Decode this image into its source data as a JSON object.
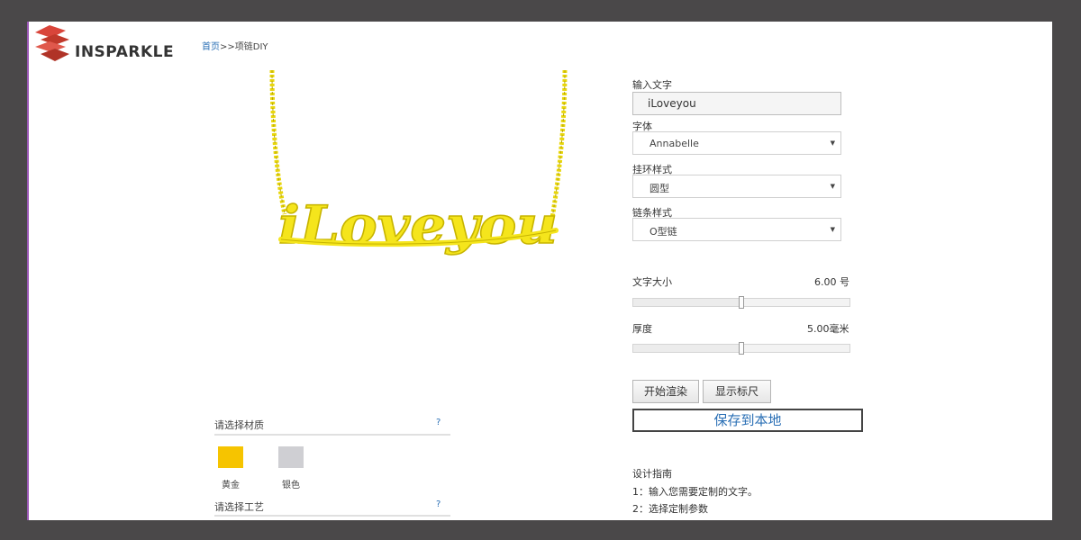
{
  "header": {
    "brand": "INSPARKLE",
    "breadcrumb_home": "首页",
    "breadcrumb_rest": ">>项链DIY"
  },
  "preview": {
    "engraved_text": "iLoveyou",
    "metal_color": "#f5e51c"
  },
  "form": {
    "text_label": "输入文字",
    "text_value": "iLoveyou",
    "font_label": "字体",
    "font_value": "Annabelle",
    "loop_label": "挂环样式",
    "loop_value": "圆型",
    "chain_label": "链条样式",
    "chain_value": "O型链"
  },
  "sliders": {
    "size_label": "文字大小",
    "size_value": "6.00 号",
    "size_level": 0.5,
    "thickness_label": "厚度",
    "thickness_value": "5.00毫米",
    "thickness_level": 0.5
  },
  "actions": {
    "render_label": "开始渲染",
    "ruler_label": "显示标尺",
    "save_label": "保存到本地"
  },
  "guide": {
    "title": "设计指南",
    "steps": [
      "1：输入您需要定制的文字。",
      "2：选择定制参数"
    ]
  },
  "materials": {
    "title": "请选择材质",
    "help": "?",
    "options": [
      {
        "label": "黄金",
        "color": "#f6c400"
      },
      {
        "label": "银色",
        "color": "#cfcfd3"
      }
    ]
  },
  "craft": {
    "title": "请选择工艺",
    "help": "?"
  },
  "colors": {
    "link": "#2a6fb5",
    "background": "#4a4849"
  }
}
